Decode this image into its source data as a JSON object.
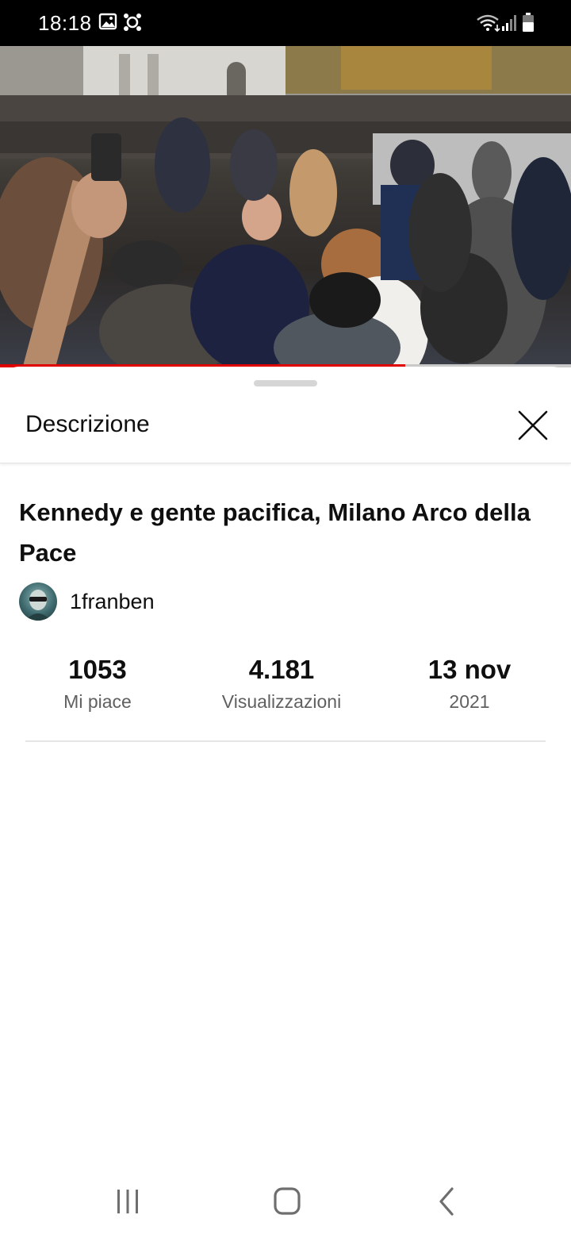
{
  "status_bar": {
    "time": "18:18",
    "icons": [
      "gallery-icon",
      "app-notification-icon",
      "wifi-icon",
      "signal-icon",
      "battery-icon"
    ]
  },
  "video": {
    "progress": 0.71,
    "colors": {
      "progress_fill": "#e00000",
      "progress_track": "#c9c9c9"
    }
  },
  "sheet": {
    "header_title": "Descrizione",
    "close_icon": "close-icon",
    "video_title": "Kennedy e gente pacifica, Milano Arco della Pace",
    "channel": {
      "name": "1franben",
      "avatar": "avatar-image"
    },
    "stats": [
      {
        "value": "1053",
        "label": "Mi piace"
      },
      {
        "value": "4.181",
        "label": "Visualizzazioni"
      },
      {
        "value": "13 nov",
        "label": "2021"
      }
    ]
  },
  "nav_bar": {
    "buttons": [
      "recent-apps-icon",
      "home-icon",
      "back-icon"
    ]
  }
}
